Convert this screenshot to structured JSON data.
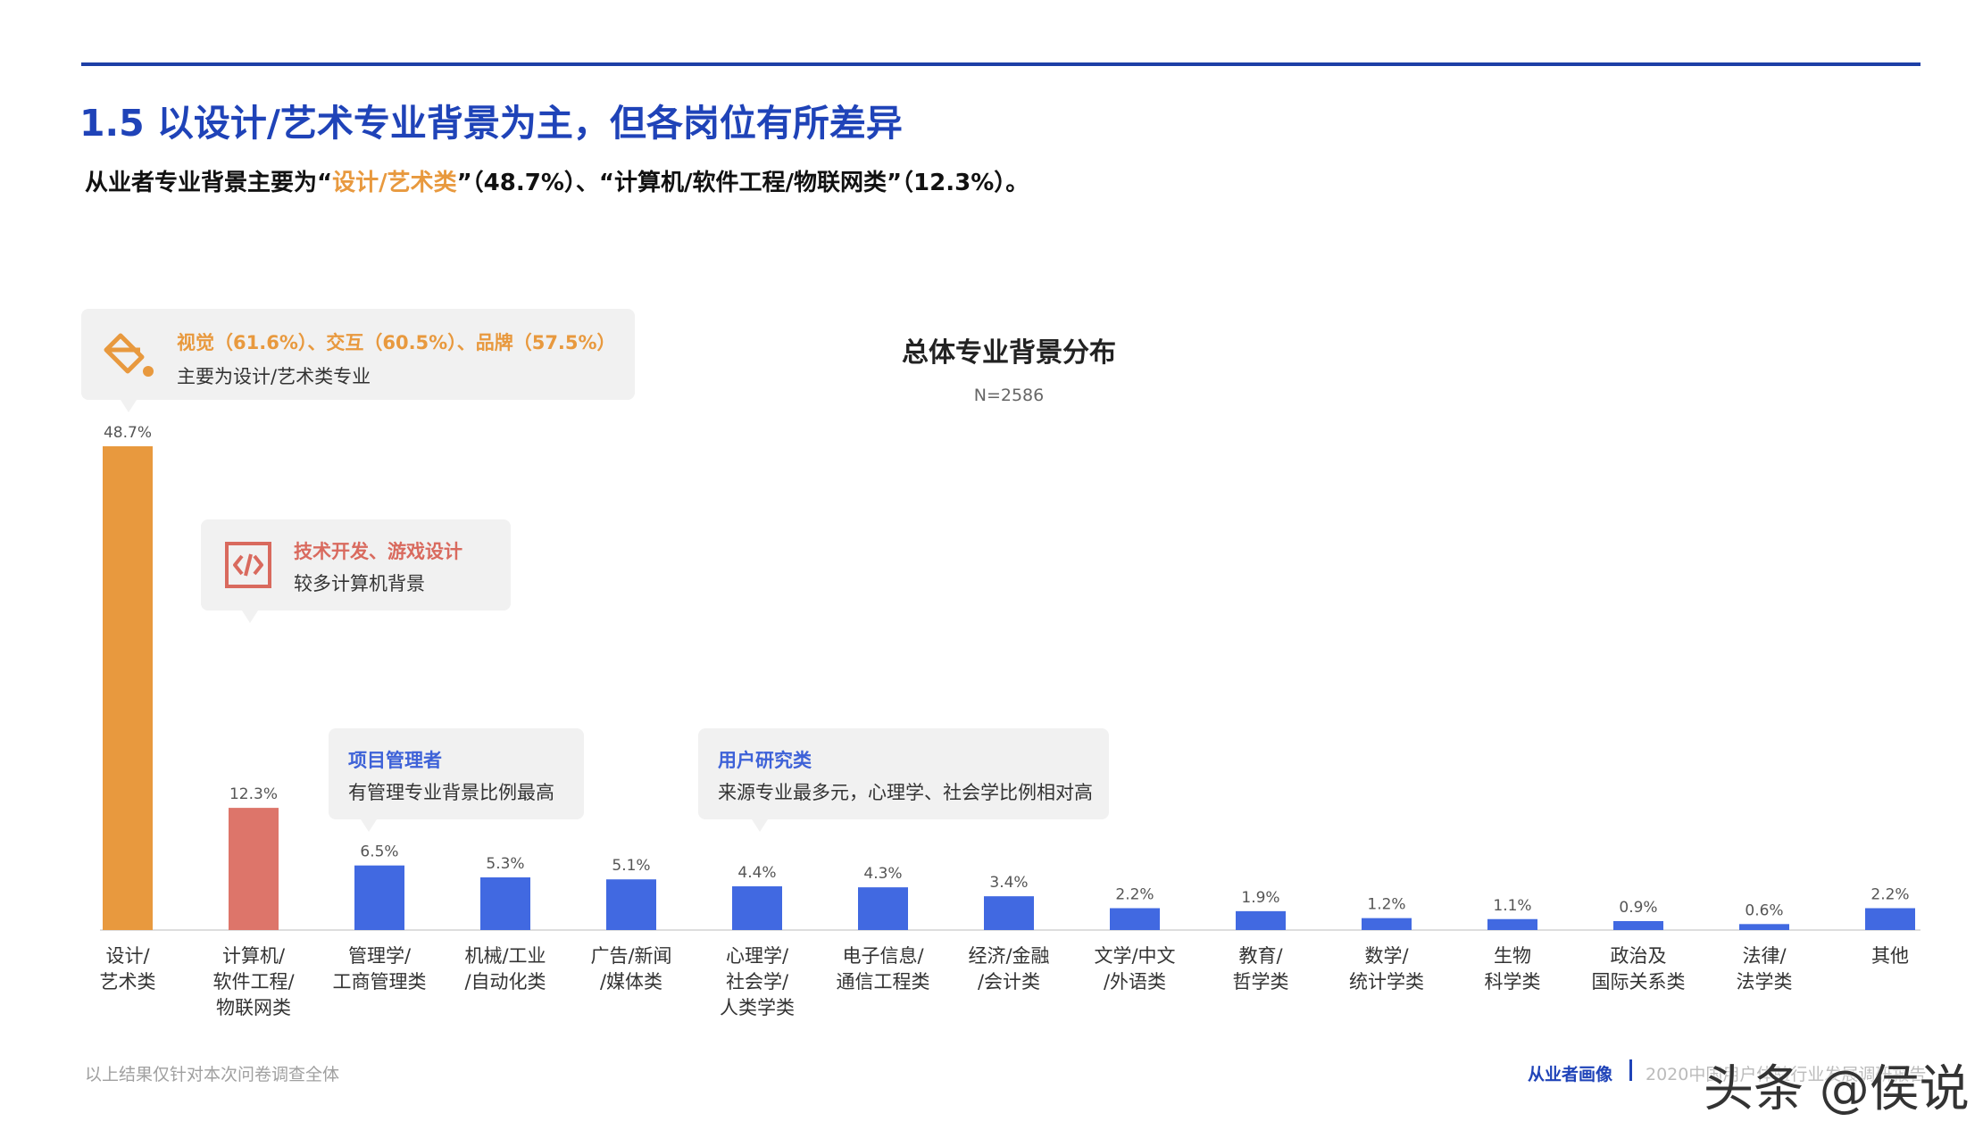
{
  "header": {
    "title": "1.5 以设计/艺术专业背景为主，但各岗位有所差异",
    "subtitle_pre": "从业者专业背景主要为“",
    "subtitle_highlight": "设计/艺术类",
    "subtitle_post": "”（48.7%）、“计算机/软件工程/物联网类”（12.3%）。"
  },
  "callouts": [
    {
      "id": "design",
      "title": "视觉（61.6%）、交互（60.5%）、品牌（57.5%）",
      "desc": "主要为设计/艺术类专业",
      "icon": "paint-bucket-icon",
      "color": "#e8993e"
    },
    {
      "id": "dev",
      "title": "技术开发、游戏设计",
      "desc": "较多计算机背景",
      "icon": "code-icon",
      "color": "#d96a5e"
    },
    {
      "id": "pm",
      "title": "项目管理者",
      "desc": "有管理专业背景比例最高",
      "icon": "",
      "color": "#3e62d8"
    },
    {
      "id": "ur",
      "title": "用户研究类",
      "desc": "来源专业最多元，心理学、社会学比例相对高",
      "icon": "",
      "color": "#3e62d8"
    }
  ],
  "colors": {
    "design": "#e8993e",
    "computer": "#dd756a",
    "other": "#4169e1",
    "axis": "#dddddd",
    "label": "#333333",
    "value": "#555555"
  },
  "chart_data": {
    "type": "bar",
    "title": "总体专业背景分布",
    "subtitle": "N=2586",
    "categories": [
      [
        "设计/",
        "艺术类"
      ],
      [
        "计算机/",
        "软件工程/",
        "物联网类"
      ],
      [
        "管理学/",
        "工商管理类"
      ],
      [
        "机械/工业",
        "/自动化类"
      ],
      [
        "广告/新闻",
        "/媒体类"
      ],
      [
        "心理学/",
        "社会学/",
        "人类学类"
      ],
      [
        "电子信息/",
        "通信工程类"
      ],
      [
        "经济/金融",
        "/会计类"
      ],
      [
        "文学/中文",
        "/外语类"
      ],
      [
        "教育/",
        "哲学类"
      ],
      [
        "数学/",
        "统计学类"
      ],
      [
        "生物",
        "科学类"
      ],
      [
        "政治及",
        "国际关系类"
      ],
      [
        "法律/",
        "法学类"
      ],
      [
        "其他"
      ]
    ],
    "values": [
      48.7,
      12.3,
      6.5,
      5.3,
      5.1,
      4.4,
      4.3,
      3.4,
      2.2,
      1.9,
      1.2,
      1.1,
      0.9,
      0.6,
      2.2
    ],
    "value_labels": [
      "48.7%",
      "12.3%",
      "6.5%",
      "5.3%",
      "5.1%",
      "4.4%",
      "4.3%",
      "3.4%",
      "2.2%",
      "1.9%",
      "1.2%",
      "1.1%",
      "0.9%",
      "0.6%",
      "2.2%"
    ],
    "ylim": [
      0,
      50
    ],
    "grid": false,
    "legend": "none"
  },
  "footer": {
    "note": "以上结果仅针对本次问卷调查全体",
    "section": "从业者画像",
    "report": "2020中国用户体验行业发展调研报告",
    "watermark": "头条 @侯说"
  }
}
